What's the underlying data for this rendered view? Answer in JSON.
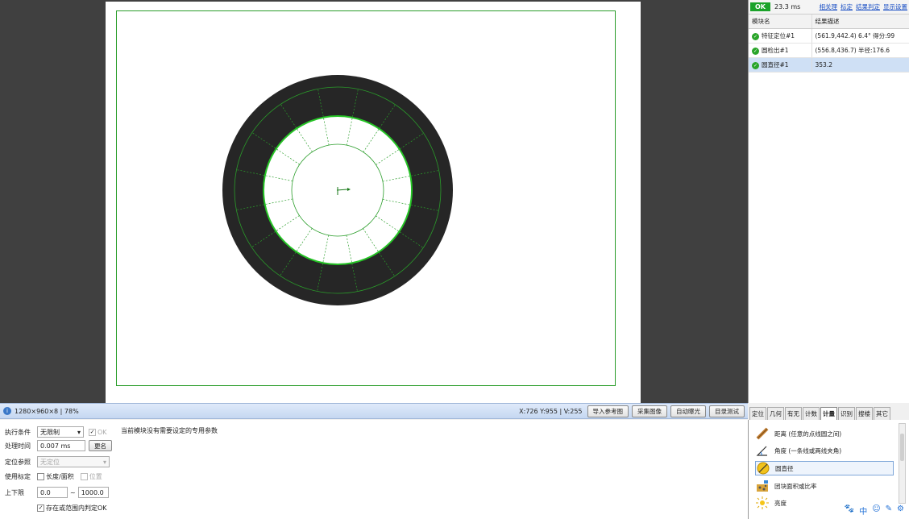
{
  "status": {
    "ok_label": "OK",
    "time": "23.3 ms",
    "links": [
      "相关理",
      "标定",
      "结果判定",
      "显示设置"
    ]
  },
  "results": {
    "headers": [
      "模块名",
      "结果描述"
    ],
    "rows": [
      {
        "name": "特征定位#1",
        "desc": "(561.9,442.4) 6.4° 得分:99"
      },
      {
        "name": "圆检出#1",
        "desc": "(556.8,436.7) 半径:176.6"
      },
      {
        "name": "圆直径#1",
        "desc": "353.2"
      }
    ]
  },
  "statusbar": {
    "image_info": "1280×960×8 | 78%",
    "coords": "X:726 Y:955 | V:255",
    "buttons": [
      "导入参考图",
      "采集图像",
      "自动曝光",
      "目录测试"
    ]
  },
  "params": {
    "exec_label": "执行条件",
    "exec_value": "无限制",
    "ok_label": "OK",
    "time_label": "处理时间",
    "time_value": "0.007 ms",
    "rename_label": "更名",
    "loc_label": "定位参照",
    "loc_value": "无定位",
    "calib_label": "使用标定",
    "calib_opt1": "长度/面积",
    "calib_opt2": "位置",
    "limit_label": "上下限",
    "limit_low": "0.0",
    "limit_sep": "~",
    "limit_high": "1000.0",
    "range_ok_label": "存在或范围内判定OK",
    "note": "当前模块没有需要设定的专用参数"
  },
  "tabs": {
    "items": [
      "定位",
      "几何",
      "有无",
      "计数",
      "计量",
      "识别",
      "搜楼",
      "其它"
    ],
    "active": 4
  },
  "tools": [
    {
      "label": "距离 (任意的点线圆之间)",
      "icon": "ruler-icon"
    },
    {
      "label": "角度 (一条线或两线夹角)",
      "icon": "angle-icon"
    },
    {
      "label": "圆直径",
      "icon": "circle-diameter-icon"
    },
    {
      "label": "团块面积或比率",
      "icon": "blob-area-icon"
    },
    {
      "label": "亮度",
      "icon": "brightness-icon"
    }
  ],
  "tray_icons": [
    "paw-icon",
    "chinese-input-icon",
    "smiley-icon",
    "pen-icon",
    "gear-icon"
  ],
  "colors": {
    "ok_green": "#1aa32a",
    "overlay_green": "#2a9d2a",
    "selection_blue": "#cfe0f5"
  }
}
